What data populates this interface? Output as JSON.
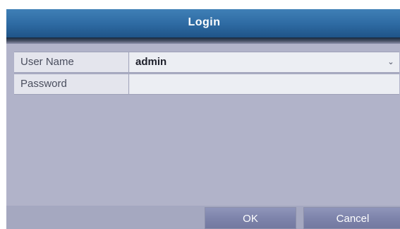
{
  "dialog": {
    "title": "Login"
  },
  "form": {
    "username": {
      "label": "User Name",
      "value": "admin"
    },
    "password": {
      "label": "Password",
      "value": ""
    }
  },
  "buttons": {
    "ok": "OK",
    "cancel": "Cancel"
  },
  "icons": {
    "username_dropdown": "chevron-down-icon"
  },
  "colors": {
    "titlebar": "#2f6ca4",
    "panel": "#b1b3c9",
    "button": "#7e84ab"
  }
}
